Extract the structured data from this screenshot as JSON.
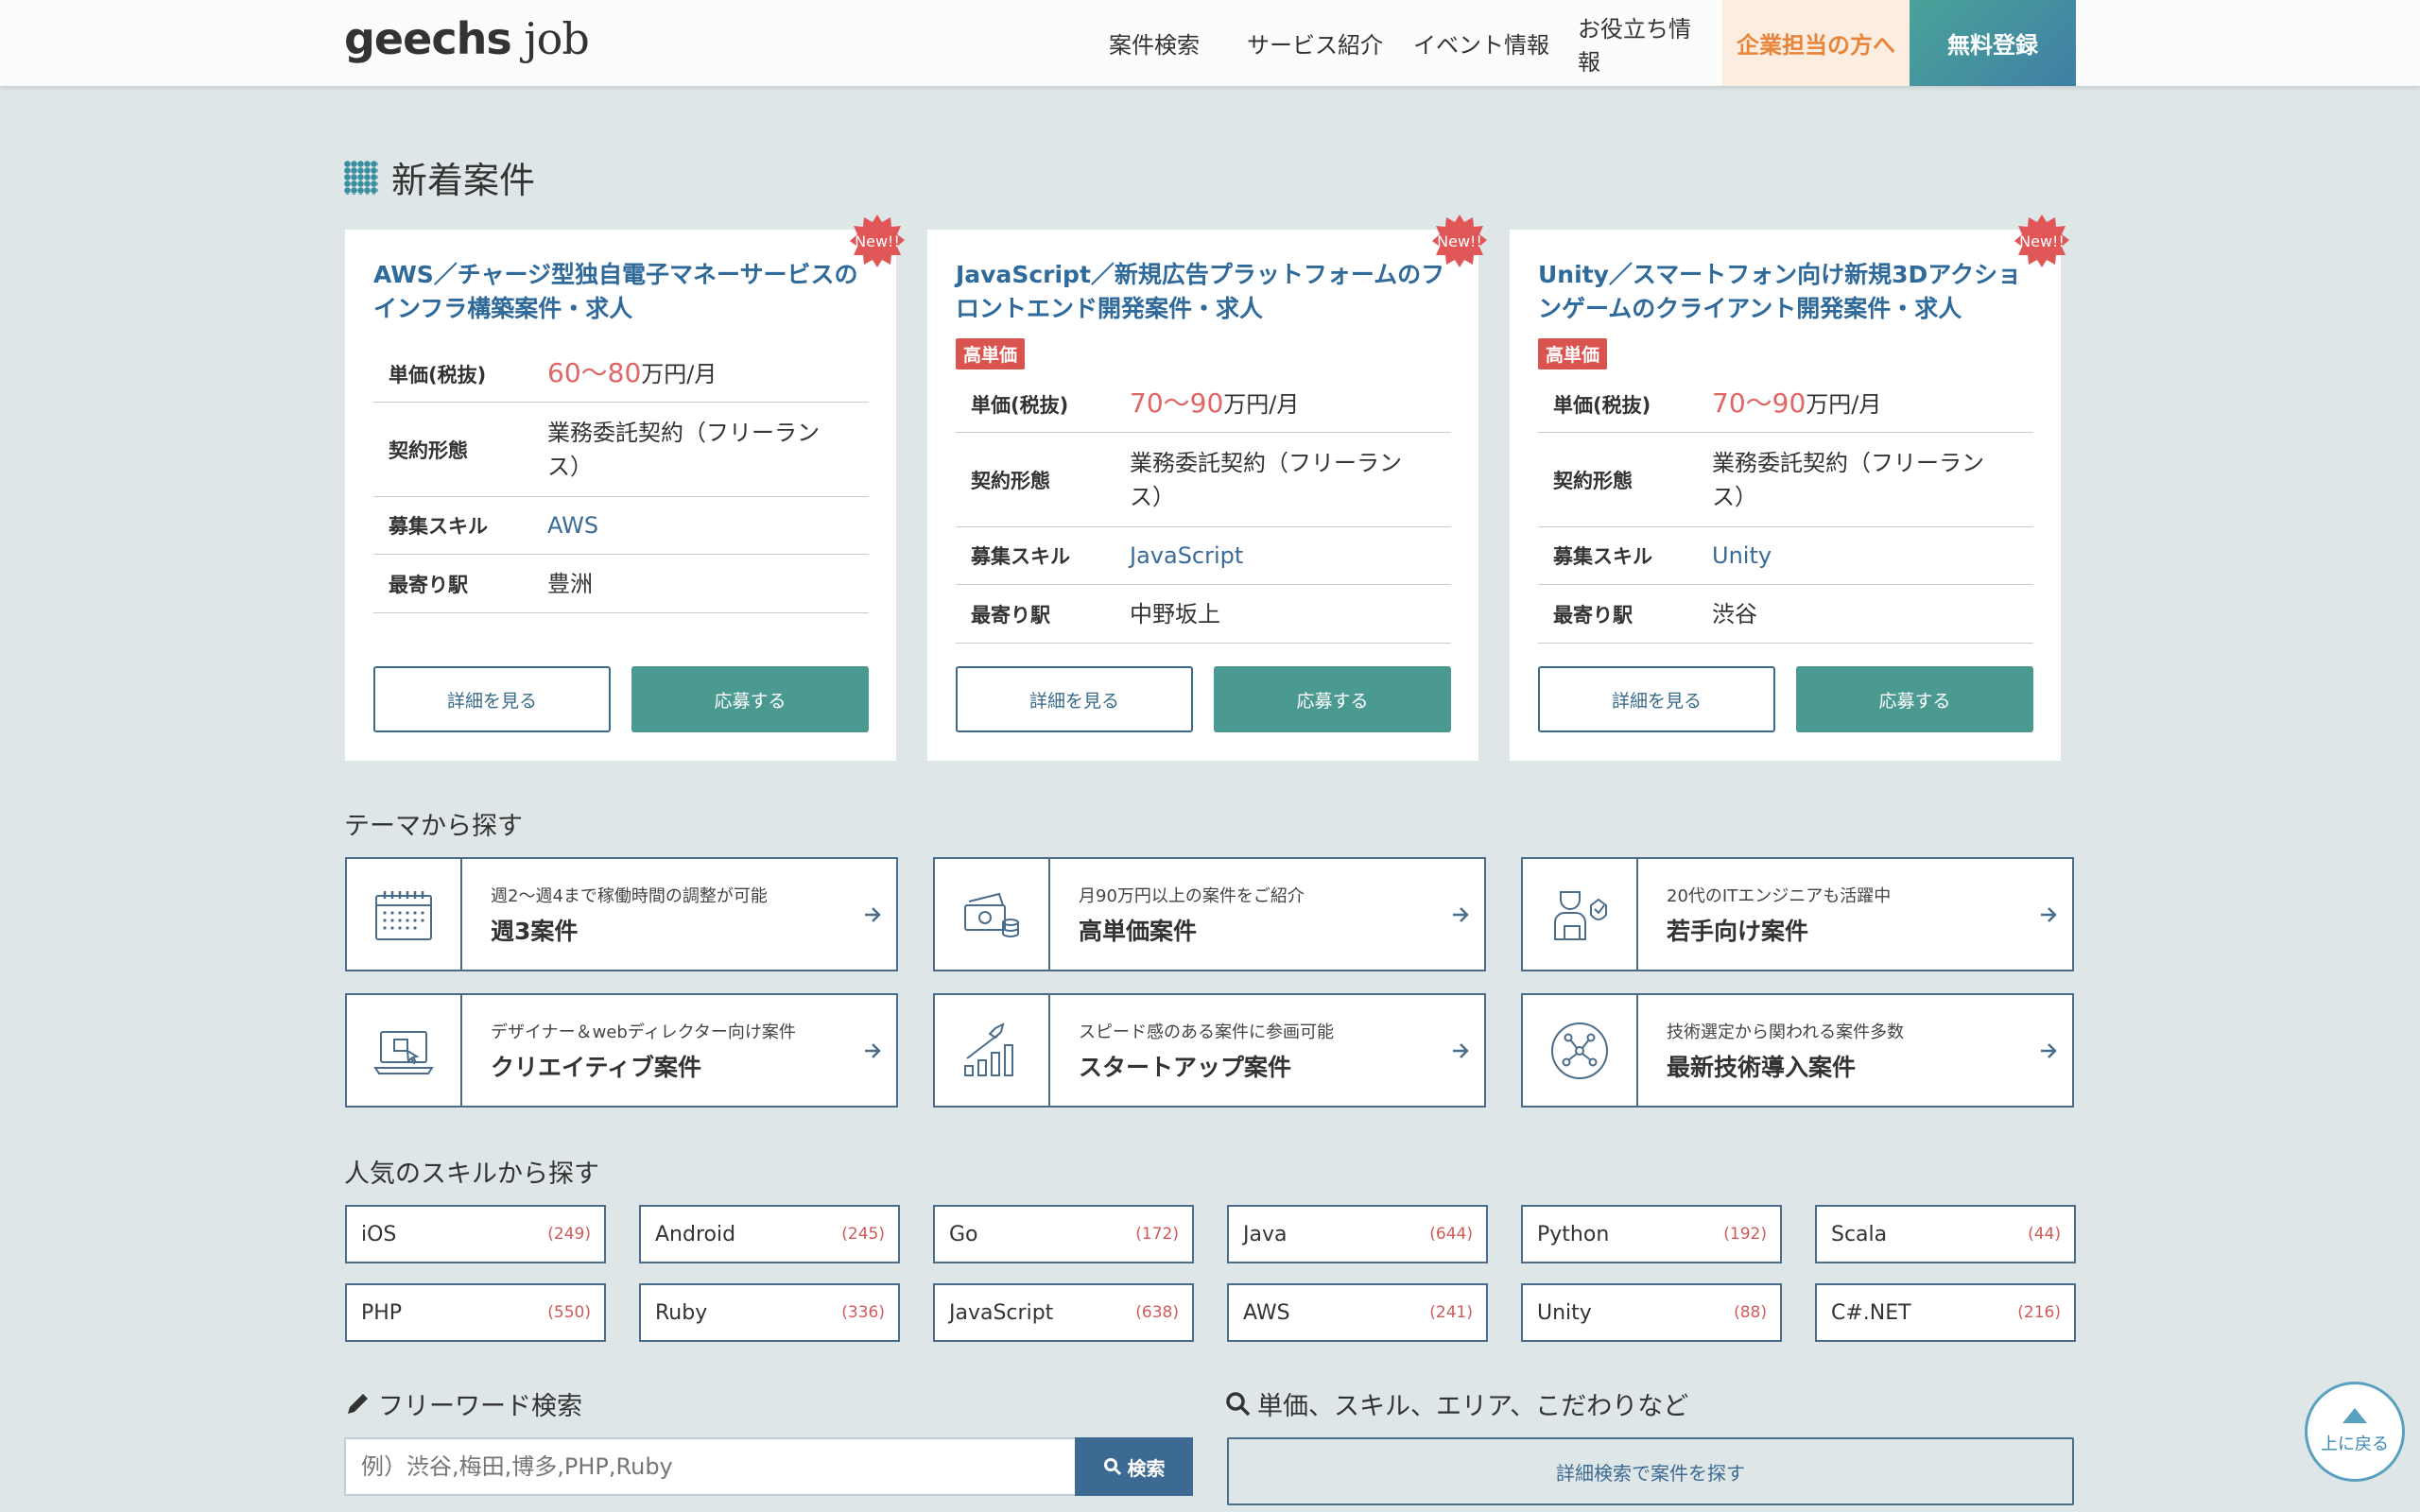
{
  "header": {
    "logo_main": "geechs",
    "logo_sub": "job",
    "nav": [
      "案件検索",
      "サービス紹介",
      "イベント情報",
      "お役立ち情報",
      "企業担当の方へ",
      "無料登録"
    ]
  },
  "new_jobs": {
    "title": "新着案件",
    "badge": "New!!",
    "labels": {
      "price": "単価(税抜)",
      "contract": "契約形態",
      "skill": "募集スキル",
      "station": "最寄り駅"
    },
    "detail_label": "詳細を見る",
    "apply_label": "応募する",
    "high_tag": "高単価",
    "unit": "万円/月",
    "cards": [
      {
        "title": "AWS／チャージ型独自電子マネーサービスのインフラ構築案件・求人",
        "high": false,
        "price": "60〜80",
        "contract": "業務委託契約（フリーランス）",
        "skill": "AWS",
        "station": "豊洲"
      },
      {
        "title": "JavaScript／新規広告プラットフォームのフロントエンド開発案件・求人",
        "high": true,
        "price": "70〜90",
        "contract": "業務委託契約（フリーランス）",
        "skill": "JavaScript",
        "station": "中野坂上"
      },
      {
        "title": "Unity／スマートフォン向け新規3Dアクションゲームのクライアント開発案件・求人",
        "high": true,
        "price": "70〜90",
        "contract": "業務委託契約（フリーランス）",
        "skill": "Unity",
        "station": "渋谷"
      }
    ]
  },
  "themes": {
    "title": "テーマから探す",
    "items": [
      {
        "sub": "週2〜週4まで稼働時間の調整が可能",
        "main": "週3案件",
        "icon": "calendar-icon"
      },
      {
        "sub": "月90万円以上の案件をご紹介",
        "main": "高単価案件",
        "icon": "money-icon"
      },
      {
        "sub": "20代のITエンジニアも活躍中",
        "main": "若手向け案件",
        "icon": "young-engineer-icon"
      },
      {
        "sub": "デザイナー＆webディレクター向け案件",
        "main": "クリエイティブ案件",
        "icon": "laptop-design-icon"
      },
      {
        "sub": "スピード感のある案件に参画可能",
        "main": "スタートアップ案件",
        "icon": "rocket-growth-icon"
      },
      {
        "sub": "技術選定から関われる案件多数",
        "main": "最新技術導入案件",
        "icon": "network-icon"
      }
    ]
  },
  "skills": {
    "title": "人気のスキルから探す",
    "items": [
      {
        "name": "iOS",
        "count": "(249)"
      },
      {
        "name": "Android",
        "count": "(245)"
      },
      {
        "name": "Go",
        "count": "(172)"
      },
      {
        "name": "Java",
        "count": "(644)"
      },
      {
        "name": "Python",
        "count": "(192)"
      },
      {
        "name": "Scala",
        "count": "(44)"
      },
      {
        "name": "PHP",
        "count": "(550)"
      },
      {
        "name": "Ruby",
        "count": "(336)"
      },
      {
        "name": "JavaScript",
        "count": "(638)"
      },
      {
        "name": "AWS",
        "count": "(241)"
      },
      {
        "name": "Unity",
        "count": "(88)"
      },
      {
        "name": "C#.NET",
        "count": "(216)"
      }
    ]
  },
  "search": {
    "free_title": "フリーワード検索",
    "placeholder": "例）渋谷,梅田,博多,PHP,Ruby",
    "search_label": "検索",
    "adv_title": "単価、スキル、エリア、こだわりなど",
    "adv_button": "詳細検索で案件を探す"
  },
  "back_to_top": "上に戻る",
  "colors": {
    "accent": "#4b9a91",
    "link": "#2f6a9a",
    "price": "#e06565",
    "corp": "#e8853a"
  }
}
